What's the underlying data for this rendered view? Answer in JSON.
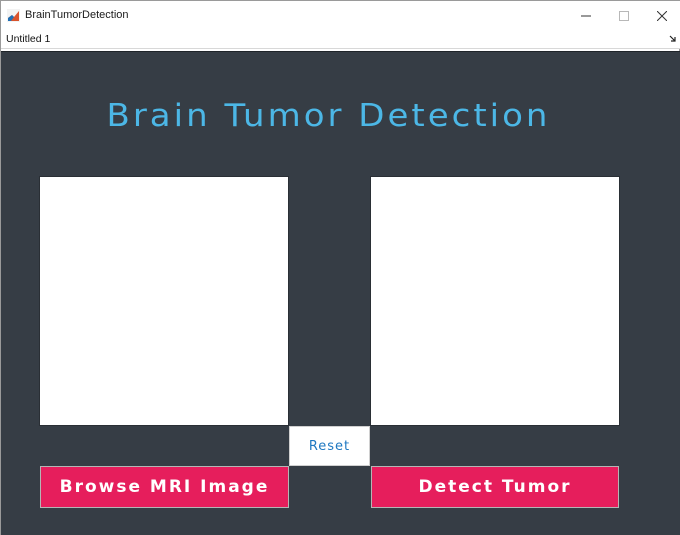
{
  "window": {
    "title": "BrainTumorDetection",
    "menu_label": "Untitled 1"
  },
  "app": {
    "heading": "Brain Tumor Detection",
    "heading_color": "#4cb7e6",
    "background_color": "#363d45"
  },
  "buttons": {
    "reset_label": "Reset",
    "browse_label": "Browse MRI Image",
    "detect_label": "Detect Tumor",
    "accent_color": "#e61e5c"
  },
  "icons": {
    "app": "matlab-logo-icon",
    "minimize": "minimize-icon",
    "maximize": "maximize-icon",
    "close": "close-icon",
    "menu_arrow": "dock-arrow-icon"
  }
}
